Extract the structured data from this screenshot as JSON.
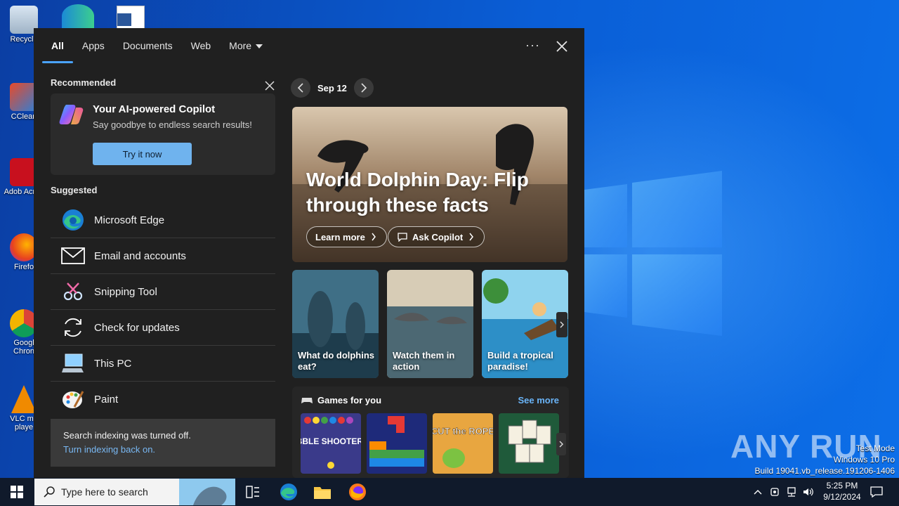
{
  "desktop": {
    "icons": [
      {
        "label": "Recycle"
      },
      {
        "label": "CClean"
      },
      {
        "label": "Adob Acrob"
      },
      {
        "label": "Firefo"
      },
      {
        "label": "Googl Chron"
      },
      {
        "label": "VLC me playe"
      }
    ],
    "watermark": {
      "brand": "ANY RUN",
      "lines": [
        "Test Mode",
        "Windows 10 Pro",
        "Build 19041.vb_release.191206-1406"
      ]
    }
  },
  "search_panel": {
    "tabs": [
      {
        "label": "All",
        "active": true
      },
      {
        "label": "Apps"
      },
      {
        "label": "Documents"
      },
      {
        "label": "Web"
      },
      {
        "label": "More"
      }
    ],
    "options_label": "···",
    "recommended": {
      "title": "Recommended",
      "card": {
        "title": "Your AI-powered Copilot",
        "subtitle": "Say goodbye to endless search results!",
        "button": "Try it now"
      }
    },
    "suggested": {
      "title": "Suggested",
      "items": [
        {
          "label": "Microsoft Edge",
          "icon": "edge-icon"
        },
        {
          "label": "Email and accounts",
          "icon": "mail-icon"
        },
        {
          "label": "Snipping Tool",
          "icon": "snipping-tool-icon"
        },
        {
          "label": "Check for updates",
          "icon": "refresh-icon"
        },
        {
          "label": "This PC",
          "icon": "computer-icon"
        },
        {
          "label": "Paint",
          "icon": "paint-icon"
        }
      ]
    },
    "indexing": {
      "text": "Search indexing was turned off.",
      "link": "Turn indexing back on."
    },
    "highlights": {
      "date": "Sep 12",
      "hero": {
        "title": "World Dolphin Day: Flip through these facts",
        "learn_more": "Learn more",
        "ask_copilot": "Ask Copilot"
      },
      "cards": [
        {
          "label": "What do dolphins eat?"
        },
        {
          "label": "Watch them in action"
        },
        {
          "label": "Build a tropical paradise!"
        }
      ],
      "games": {
        "title": "Games for you",
        "see_more": "See more",
        "items": [
          {
            "name": "Bubble Shooter HD",
            "art": "BUBBLE SHOOTER HD"
          },
          {
            "name": "Block puzzle"
          },
          {
            "name": "Cut the Rope",
            "art": "CUT the ROPE"
          },
          {
            "name": "Mahjong"
          }
        ]
      }
    }
  },
  "taskbar": {
    "search_placeholder": "Type here to search",
    "time": "5:25 PM",
    "date": "9/12/2024"
  }
}
